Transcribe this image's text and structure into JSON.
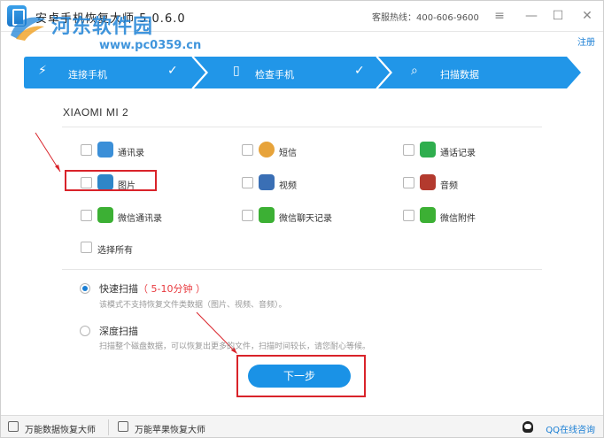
{
  "window": {
    "title": "安卓手机恢复大师 5.0.6.0",
    "hotline": "客服热线：400-606-9600",
    "register_label": "注册",
    "watermark_name": "河东软件园",
    "watermark_url": "www.pc0359.cn"
  },
  "steps": [
    {
      "label": "连接手机",
      "icon": "plug-icon",
      "done": true
    },
    {
      "label": "检查手机",
      "icon": "phone-icon",
      "done": true
    },
    {
      "label": "扫描数据",
      "icon": "search-icon",
      "done": false
    }
  ],
  "device_name": "XIAOMI MI 2",
  "options": [
    {
      "label": "通讯录",
      "icon": "contacts-icon",
      "color": "#3b8fd8",
      "checked": false
    },
    {
      "label": "短信",
      "icon": "sms-icon",
      "color": "#e7a33a",
      "checked": false
    },
    {
      "label": "通话记录",
      "icon": "call-log-icon",
      "color": "#2fae4e",
      "checked": false
    },
    {
      "label": "图片",
      "icon": "picture-icon",
      "color": "#2f86c8",
      "checked": false
    },
    {
      "label": "视频",
      "icon": "video-icon",
      "color": "#3a6fb5",
      "checked": false
    },
    {
      "label": "音频",
      "icon": "audio-icon",
      "color": "#b33a2e",
      "checked": false
    },
    {
      "label": "微信通讯录",
      "icon": "wechat-contacts-icon",
      "color": "#3cb034",
      "checked": false
    },
    {
      "label": "微信聊天记录",
      "icon": "wechat-chat-icon",
      "color": "#3cb034",
      "checked": false
    },
    {
      "label": "微信附件",
      "icon": "wechat-attachment-icon",
      "color": "#3cb034",
      "checked": false
    },
    {
      "label": "选择所有",
      "icon": "",
      "color": "",
      "checked": false
    }
  ],
  "scan_modes": [
    {
      "title": "快速扫描",
      "highlight": "（ 5-10分钟 ）",
      "desc": "该模式不支持恢复文件类数据（图片、视频、音频）。",
      "selected": true
    },
    {
      "title": "深度扫描",
      "highlight": "",
      "desc": "扫描整个磁盘数据，可以恢复出更多的文件，扫描时间较长，请您耐心等候。",
      "selected": false
    }
  ],
  "next_button_label": "下一步",
  "footer": {
    "item1": "万能数据恢复大师",
    "item2": "万能苹果恢复大师",
    "qq": "QQ在线咨询"
  },
  "colors": {
    "accent": "#1a92e6",
    "annotation_red": "#d9232a"
  }
}
